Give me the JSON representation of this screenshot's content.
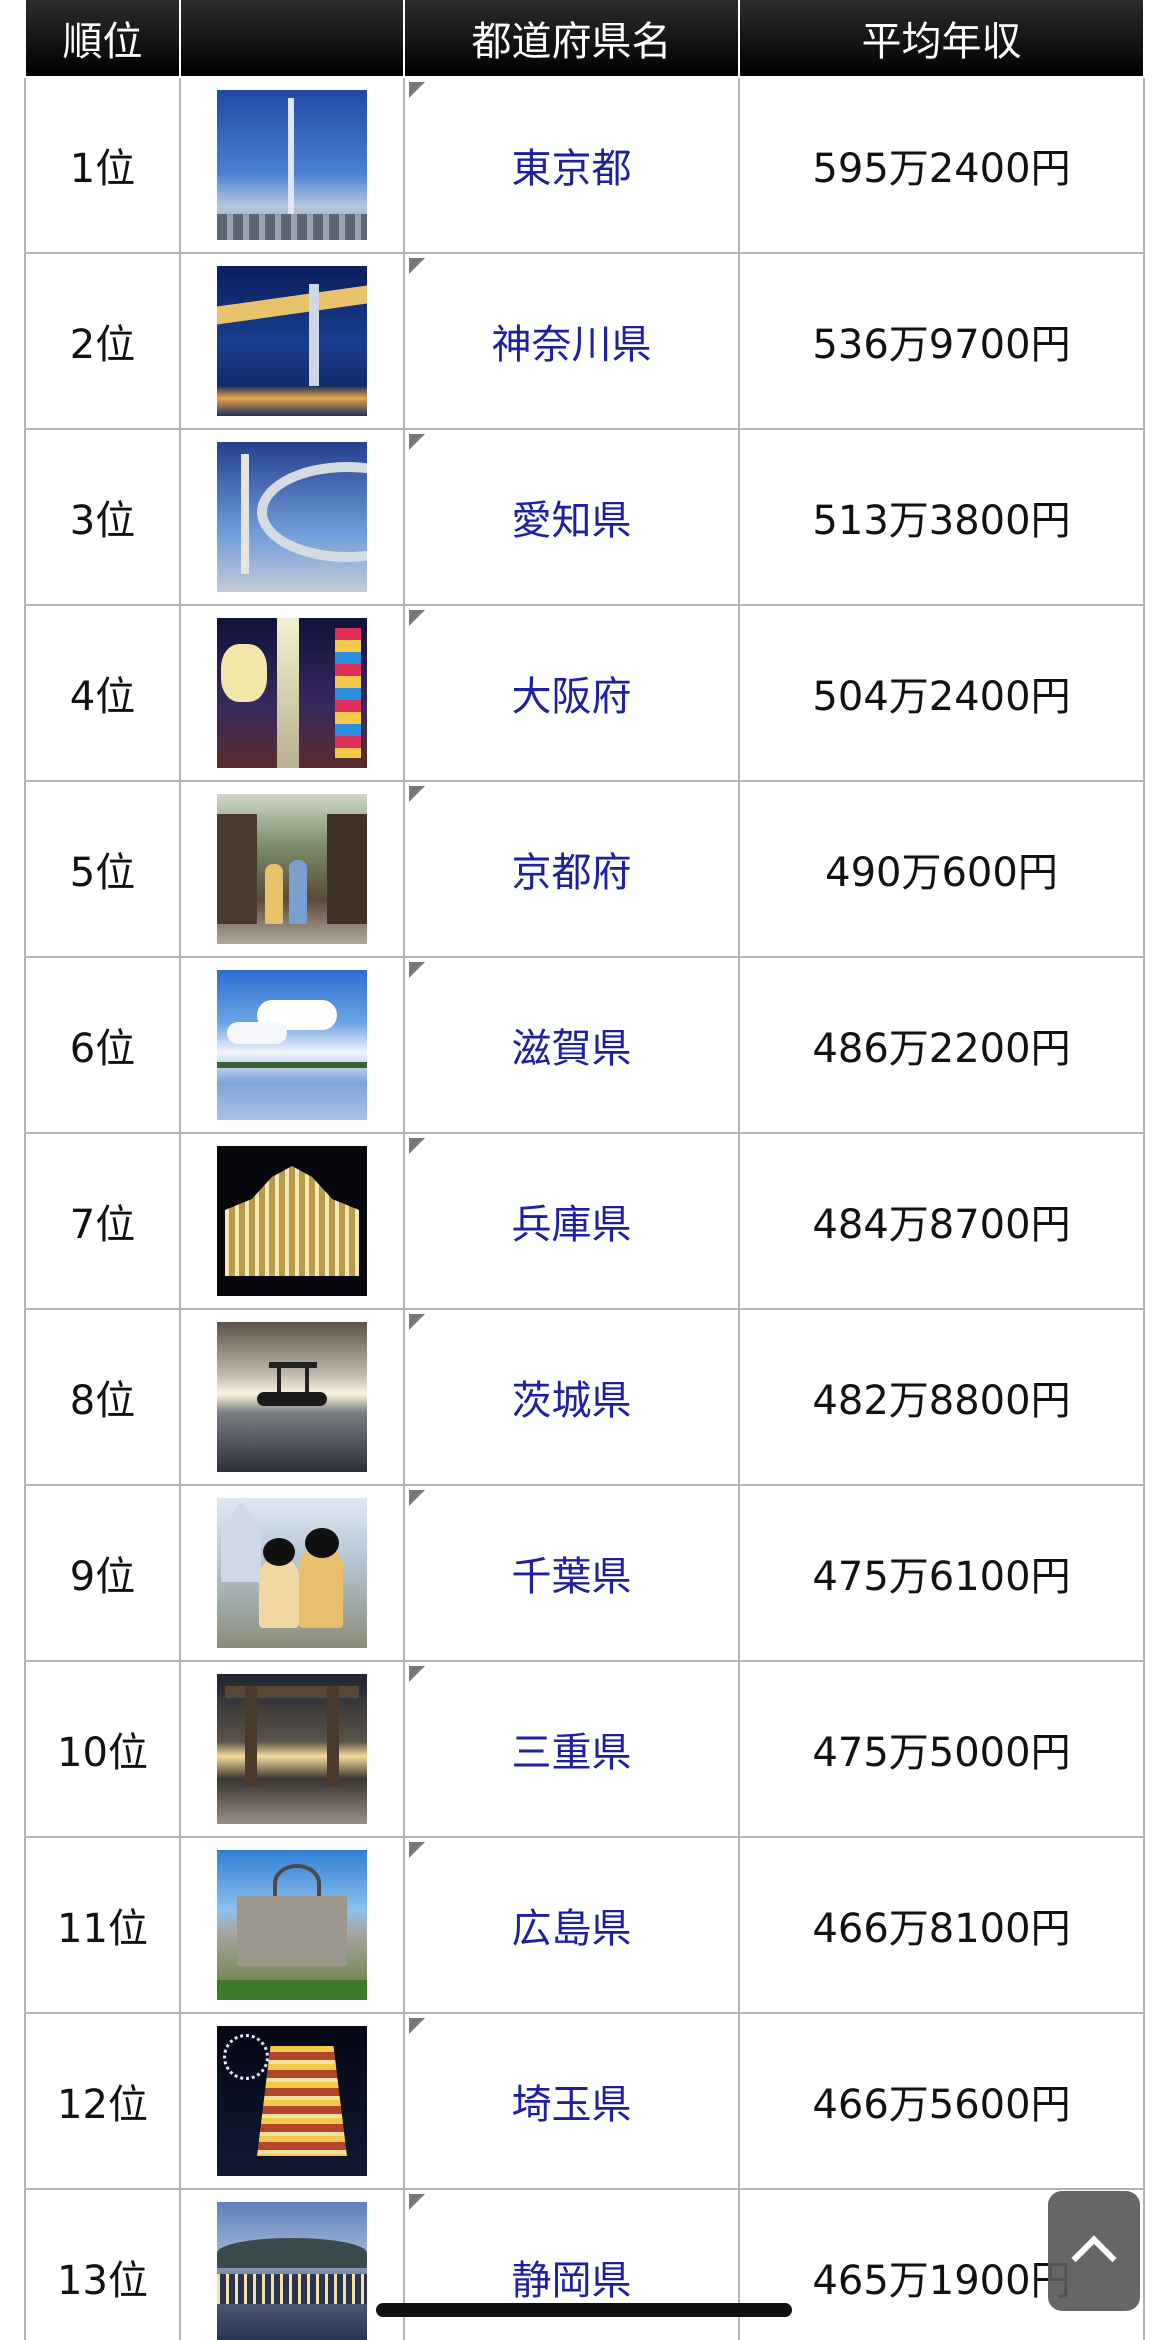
{
  "table": {
    "headers": {
      "rank": "順位",
      "image": "",
      "prefecture": "都道府県名",
      "income": "平均年収"
    },
    "rows": [
      {
        "rank": "1位",
        "prefecture": "東京都",
        "income": "595万2400円",
        "photo_icon": "tokyo-skytree-photo"
      },
      {
        "rank": "2位",
        "prefecture": "神奈川県",
        "income": "536万9700円",
        "photo_icon": "yokohama-bay-bridge-photo"
      },
      {
        "rank": "3位",
        "prefecture": "愛知県",
        "income": "513万3800円",
        "photo_icon": "nagoya-oasis21-photo"
      },
      {
        "rank": "4位",
        "prefecture": "大阪府",
        "income": "504万2400円",
        "photo_icon": "tsutenkaku-photo"
      },
      {
        "rank": "5位",
        "prefecture": "京都府",
        "income": "490万600円",
        "photo_icon": "kyoto-street-photo"
      },
      {
        "rank": "6位",
        "prefecture": "滋賀県",
        "income": "486万2200円",
        "photo_icon": "lake-biwa-photo"
      },
      {
        "rank": "7位",
        "prefecture": "兵庫県",
        "income": "484万8700円",
        "photo_icon": "kobe-luminarie-photo"
      },
      {
        "rank": "8位",
        "prefecture": "茨城県",
        "income": "482万8800円",
        "photo_icon": "seaside-torii-photo"
      },
      {
        "rank": "9位",
        "prefecture": "千葉県",
        "income": "475万6100円",
        "photo_icon": "disney-resort-photo"
      },
      {
        "rank": "10位",
        "prefecture": "三重県",
        "income": "475万5000円",
        "photo_icon": "ise-torii-photo"
      },
      {
        "rank": "11位",
        "prefecture": "広島県",
        "income": "466万8100円",
        "photo_icon": "atomic-dome-photo"
      },
      {
        "rank": "12位",
        "prefecture": "埼玉県",
        "income": "466万5600円",
        "photo_icon": "chichibu-festival-photo"
      },
      {
        "rank": "13位",
        "prefecture": "静岡県",
        "income": "465万1900円",
        "photo_icon": "atami-night-view-photo"
      }
    ]
  },
  "scroll_top_button": {
    "icon": "chevron-up-icon"
  },
  "colors": {
    "header_bg": "#000000",
    "header_text": "#ffffff",
    "link": "#1f1fa0",
    "border": "#b3b3b3",
    "scroll_button_bg": "#5a5a5a"
  }
}
